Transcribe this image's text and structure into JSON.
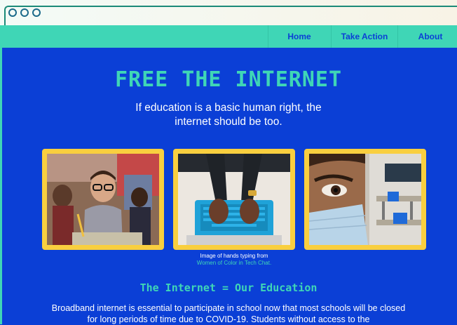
{
  "browser": {
    "window_controls": [
      "circle-icon",
      "circle-icon",
      "circle-icon"
    ]
  },
  "nav": {
    "items": [
      {
        "label": "Home"
      },
      {
        "label": "Take Action"
      },
      {
        "label": "About"
      }
    ]
  },
  "hero": {
    "title": "FREE THE INTERNET",
    "subtitle": "If education is a basic human right, the internet should be too."
  },
  "photos": {
    "caption_text": "Image of hands typing from",
    "caption_link": "Women of Color in Tech Chat."
  },
  "section": {
    "title": "The Internet = Our Education",
    "body": "Broadband internet is essential to participate in school now that most schools will be closed for long periods of time due to COVID-19. Students without access to the"
  },
  "colors": {
    "background": "#0b3fd6",
    "accent": "#3fd6b6",
    "frame": "#f9cf3f",
    "text": "#ffffff"
  }
}
